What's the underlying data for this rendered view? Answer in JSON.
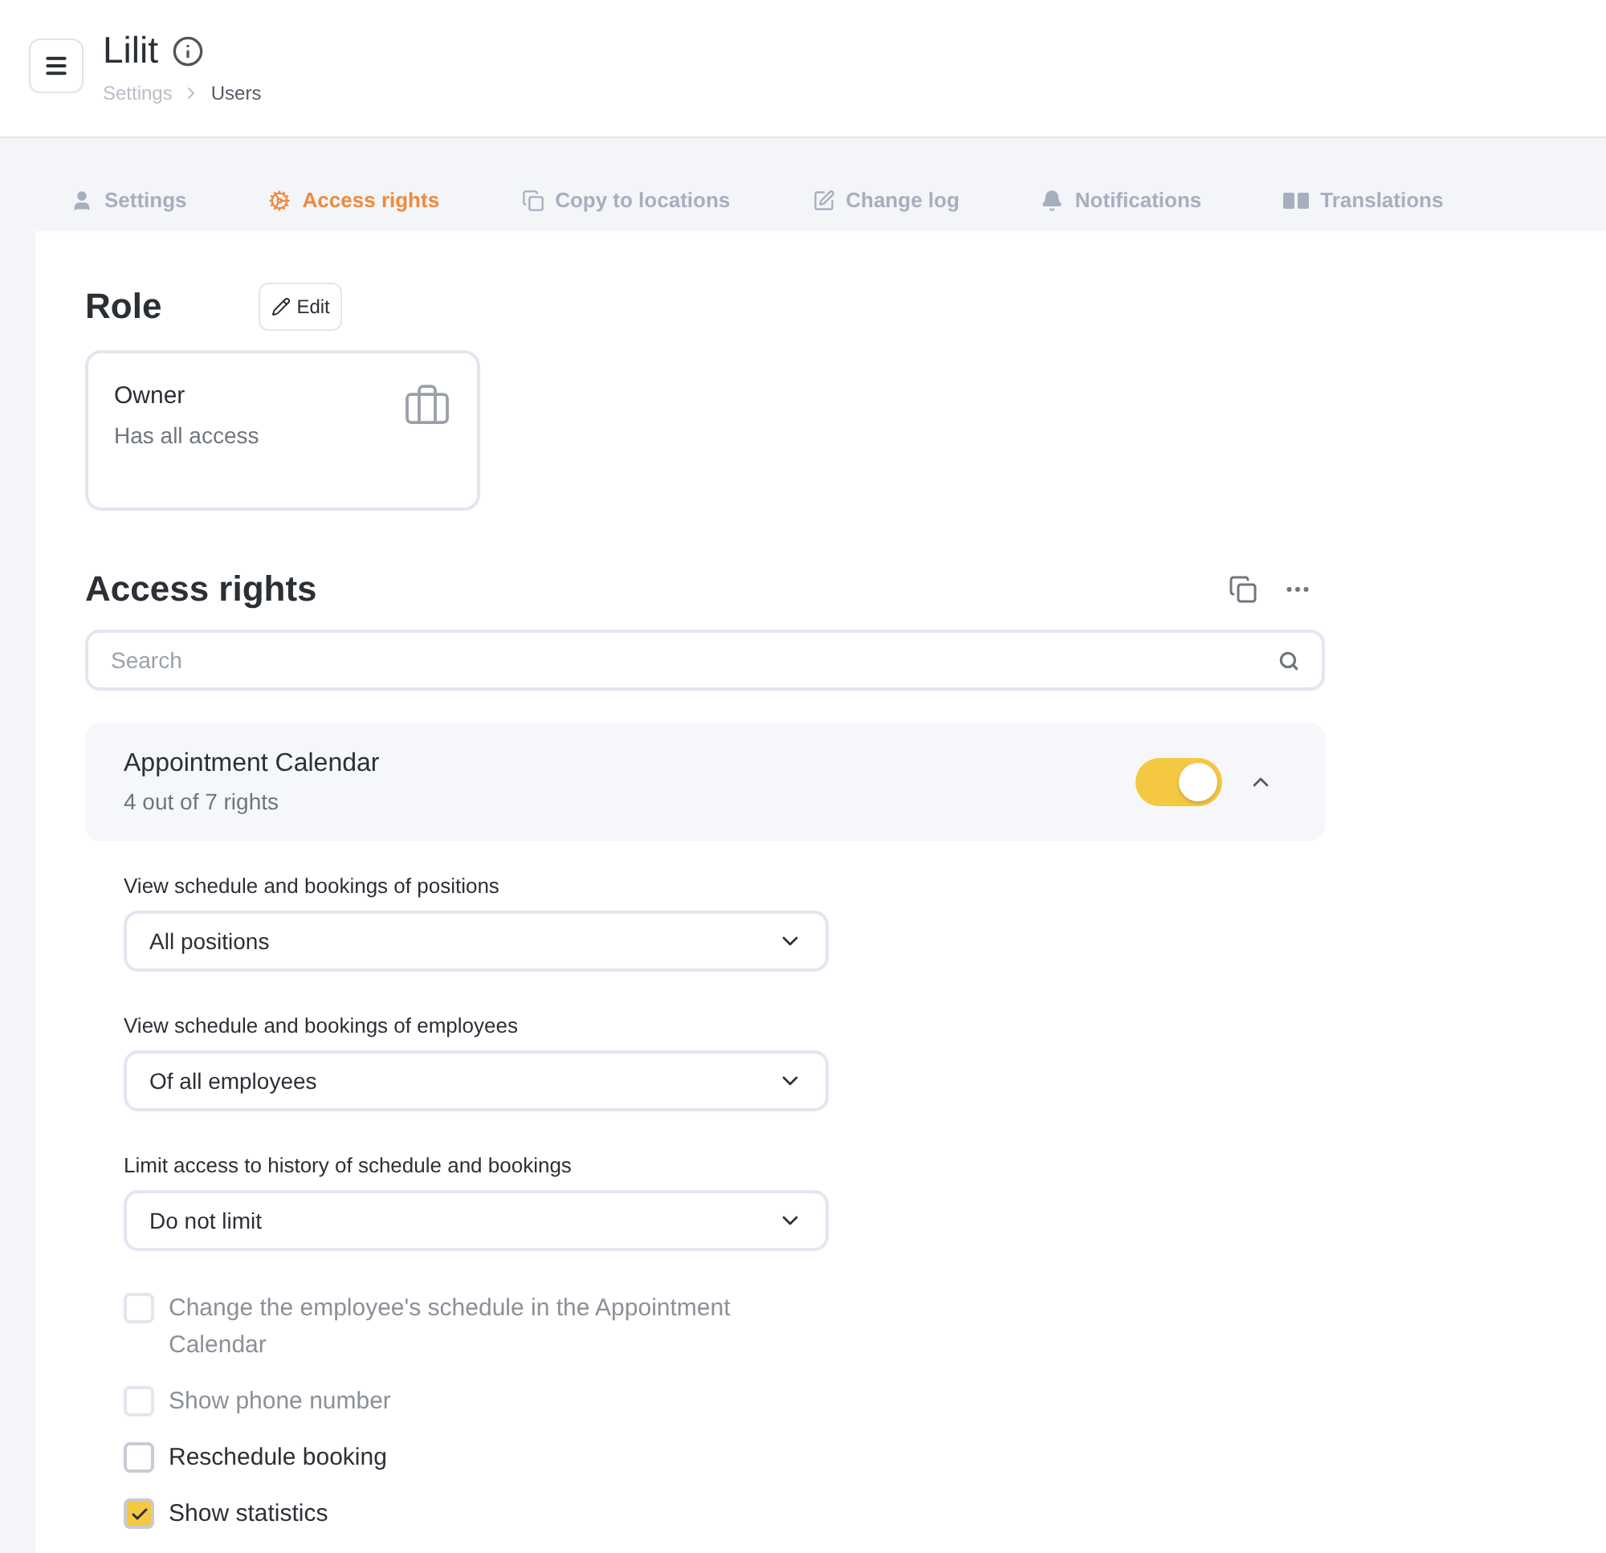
{
  "header": {
    "title": "Lilit",
    "breadcrumbs": [
      "Settings",
      "Users"
    ]
  },
  "tabs": [
    {
      "label": "Settings",
      "selected": false
    },
    {
      "label": "Access rights",
      "selected": true
    },
    {
      "label": "Copy to locations",
      "selected": false
    },
    {
      "label": "Change log",
      "selected": false
    },
    {
      "label": "Notifications",
      "selected": false
    },
    {
      "label": "Translations",
      "selected": false
    }
  ],
  "role": {
    "heading": "Role",
    "edit_button": "Edit",
    "card": {
      "name": "Owner",
      "description": "Has all access"
    }
  },
  "access_rights": {
    "heading": "Access rights",
    "search": {
      "placeholder": "Search"
    },
    "groups": [
      {
        "name": "Appointment Calendar",
        "summary": "4 out of 7 rights",
        "on": true,
        "expanded": true,
        "selects": [
          {
            "label": "View schedule and bookings of positions",
            "value": "All positions"
          },
          {
            "label": "View schedule and bookings of employees",
            "value": "Of all employees"
          },
          {
            "label": "Limit access to history of schedule and bookings",
            "value": "Do not limit"
          }
        ],
        "checkboxes": [
          {
            "label": "Change the employee's schedule in the Appointment Calendar",
            "checked": false,
            "disabled": true
          },
          {
            "label": "Show phone number",
            "checked": false,
            "disabled": true
          },
          {
            "label": "Reschedule booking",
            "checked": false,
            "disabled": false
          },
          {
            "label": "Show statistics",
            "checked": true,
            "disabled": false
          }
        ]
      }
    ]
  }
}
